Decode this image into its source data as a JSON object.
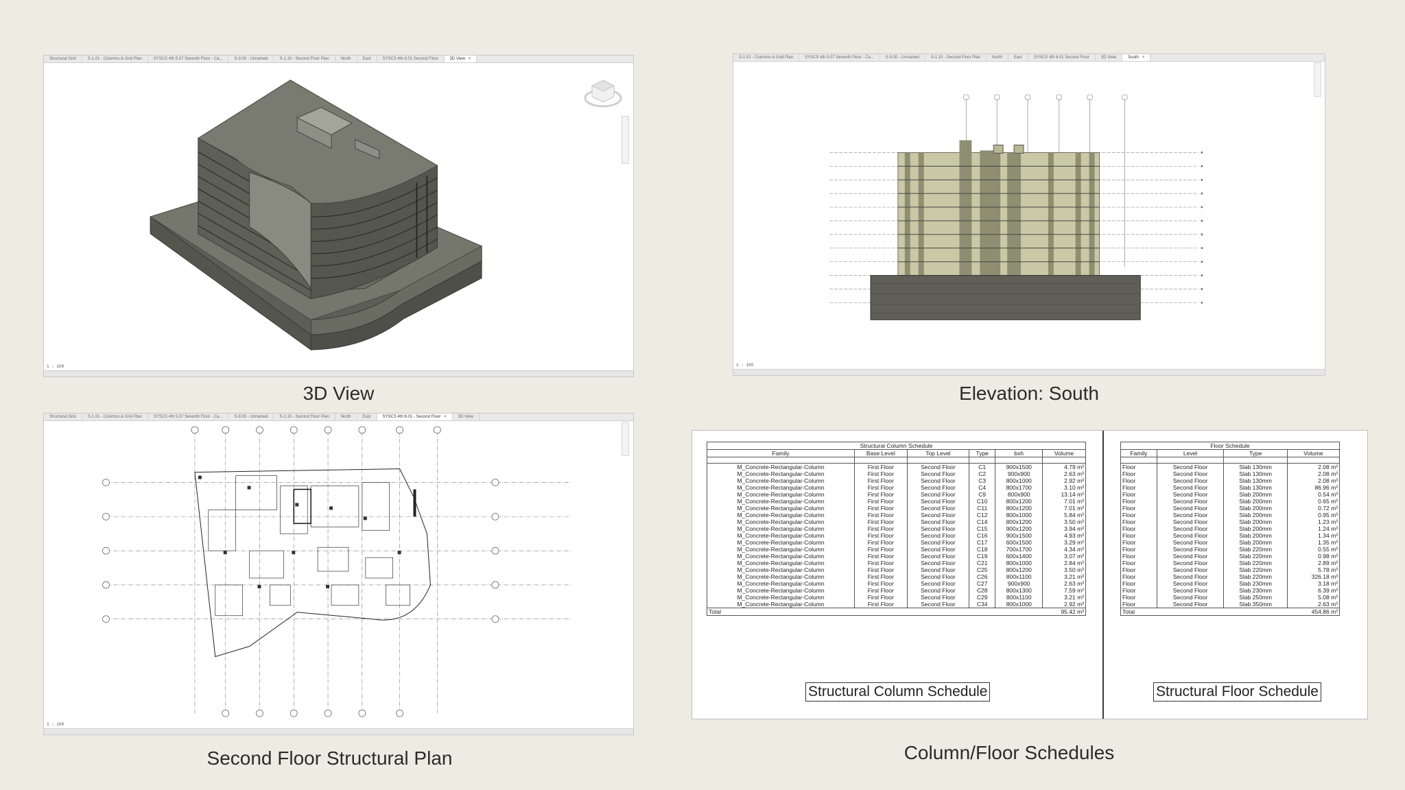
{
  "panels": {
    "view3d": {
      "tabs": [
        "Structural Grid",
        "S-1.01 - Columns & Grid Plan",
        "SYSCS 4th 5.07 Seventh Floor - Ca...",
        "S-9.00 - Unnamed",
        "S-1.10 - Second Floor Plan",
        "North",
        "East",
        "SYSCS 4th 6.01 Second Floor",
        "3D View"
      ],
      "active_tab": "3D View",
      "scale": "1 : 100",
      "caption": "3D View"
    },
    "elevation": {
      "tabs": [
        "S-1.01 - Columns & Grid Plan",
        "SYSCS 4th 5.07 Seventh Floor - Ca...",
        "S-9.00 - Unnamed",
        "S-1.10 - Second Floor Plan",
        "North",
        "East",
        "SYSCS 4th 6.01 Second Floor",
        "3D View",
        "South"
      ],
      "active_tab": "South",
      "scale": "1 : 100",
      "caption": "Elevation: South"
    },
    "plan": {
      "tabs": [
        "Structural Grid",
        "S-1.01 - Columns & Grid Plan",
        "SYSCS 4th 5.07 Seventh Floor - Ca...",
        "S-9.00 - Unnamed",
        "S-1.10 - Second Floor Plan",
        "North",
        "East",
        "SYSCS 4th 6.01 - Second Floor",
        "3D View"
      ],
      "active_tab": "SYSCS 4th 6.01 - Second Floor",
      "scale": "1 : 100",
      "caption": "Second Floor Structural Plan"
    },
    "schedules_caption": "Column/Floor Schedules"
  },
  "column_schedule": {
    "title": "Structural Column Schedule",
    "headers": [
      "Family",
      "Base Level",
      "Top Level",
      "Type",
      "bxh",
      "Volume"
    ],
    "rows": [
      [
        "M_Concrete-Rectangular-Column",
        "First Floor",
        "Second Floor",
        "C1",
        "900x1500",
        "4.79 m³"
      ],
      [
        "M_Concrete-Rectangular-Column",
        "First Floor",
        "Second Floor",
        "C2",
        "900x900",
        "2.63 m³"
      ],
      [
        "M_Concrete-Rectangular-Column",
        "First Floor",
        "Second Floor",
        "C3",
        "800x1000",
        "2.92 m³"
      ],
      [
        "M_Concrete-Rectangular-Column",
        "First Floor",
        "Second Floor",
        "C4",
        "800x1700",
        "3.10 m³"
      ],
      [
        "M_Concrete-Rectangular-Column",
        "First Floor",
        "Second Floor",
        "C9",
        "800x900",
        "13.14 m³"
      ],
      [
        "M_Concrete-Rectangular-Column",
        "First Floor",
        "Second Floor",
        "C10",
        "800x1200",
        "7.01 m³"
      ],
      [
        "M_Concrete-Rectangular-Column",
        "First Floor",
        "Second Floor",
        "C11",
        "800x1200",
        "7.01 m³"
      ],
      [
        "M_Concrete-Rectangular-Column",
        "First Floor",
        "Second Floor",
        "C12",
        "800x1000",
        "5.84 m³"
      ],
      [
        "M_Concrete-Rectangular-Column",
        "First Floor",
        "Second Floor",
        "C14",
        "800x1200",
        "3.50 m³"
      ],
      [
        "M_Concrete-Rectangular-Column",
        "First Floor",
        "Second Floor",
        "C15",
        "900x1200",
        "3.94 m³"
      ],
      [
        "M_Concrete-Rectangular-Column",
        "First Floor",
        "Second Floor",
        "C16",
        "900x1500",
        "4.93 m³"
      ],
      [
        "M_Concrete-Rectangular-Column",
        "First Floor",
        "Second Floor",
        "C17",
        "600x1500",
        "3.29 m³"
      ],
      [
        "M_Concrete-Rectangular-Column",
        "First Floor",
        "Second Floor",
        "C18",
        "700x1700",
        "4.34 m³"
      ],
      [
        "M_Concrete-Rectangular-Column",
        "First Floor",
        "Second Floor",
        "C19",
        "600x1400",
        "3.07 m³"
      ],
      [
        "M_Concrete-Rectangular-Column",
        "First Floor",
        "Second Floor",
        "C21",
        "800x1000",
        "2.84 m³"
      ],
      [
        "M_Concrete-Rectangular-Column",
        "First Floor",
        "Second Floor",
        "C25",
        "800x1200",
        "3.50 m³"
      ],
      [
        "M_Concrete-Rectangular-Column",
        "First Floor",
        "Second Floor",
        "C26",
        "800x1100",
        "3.21 m³"
      ],
      [
        "M_Concrete-Rectangular-Column",
        "First Floor",
        "Second Floor",
        "C27",
        "900x900",
        "2.63 m³"
      ],
      [
        "M_Concrete-Rectangular-Column",
        "First Floor",
        "Second Floor",
        "C28",
        "800x1300",
        "7.59 m³"
      ],
      [
        "M_Concrete-Rectangular-Column",
        "First Floor",
        "Second Floor",
        "C29",
        "800x1100",
        "3.21 m³"
      ],
      [
        "M_Concrete-Rectangular-Column",
        "First Floor",
        "Second Floor",
        "C34",
        "800x1000",
        "2.92 m³"
      ]
    ],
    "total_label": "Total",
    "total_value": "95.42 m³",
    "label": "Structural Column Schedule"
  },
  "floor_schedule": {
    "title": "Floor Schedule",
    "headers": [
      "Family",
      "Level",
      "Type",
      "Volume"
    ],
    "rows": [
      [
        "Floor",
        "Second Floor",
        "Slab 130mm",
        "2.08 m³"
      ],
      [
        "Floor",
        "Second Floor",
        "Slab 130mm",
        "2.08 m³"
      ],
      [
        "Floor",
        "Second Floor",
        "Slab 130mm",
        "2.08 m³"
      ],
      [
        "Floor",
        "Second Floor",
        "Slab 130mm",
        "86.96 m³"
      ],
      [
        "Floor",
        "Second Floor",
        "Slab 200mm",
        "0.54 m³"
      ],
      [
        "Floor",
        "Second Floor",
        "Slab 200mm",
        "0.65 m³"
      ],
      [
        "Floor",
        "Second Floor",
        "Slab 200mm",
        "0.72 m³"
      ],
      [
        "Floor",
        "Second Floor",
        "Slab 200mm",
        "0.95 m³"
      ],
      [
        "Floor",
        "Second Floor",
        "Slab 200mm",
        "1.23 m³"
      ],
      [
        "Floor",
        "Second Floor",
        "Slab 200mm",
        "1.24 m³"
      ],
      [
        "Floor",
        "Second Floor",
        "Slab 200mm",
        "1.34 m³"
      ],
      [
        "Floor",
        "Second Floor",
        "Slab 200mm",
        "1.35 m³"
      ],
      [
        "Floor",
        "Second Floor",
        "Slab 220mm",
        "0.55 m³"
      ],
      [
        "Floor",
        "Second Floor",
        "Slab 220mm",
        "0.98 m³"
      ],
      [
        "Floor",
        "Second Floor",
        "Slab 220mm",
        "2.89 m³"
      ],
      [
        "Floor",
        "Second Floor",
        "Slab 220mm",
        "5.78 m³"
      ],
      [
        "Floor",
        "Second Floor",
        "Slab 220mm",
        "326.18 m³"
      ],
      [
        "Floor",
        "Second Floor",
        "Slab 230mm",
        "3.18 m³"
      ],
      [
        "Floor",
        "Second Floor",
        "Slab 230mm",
        "6.39 m³"
      ],
      [
        "Floor",
        "Second Floor",
        "Slab 250mm",
        "5.08 m³"
      ],
      [
        "Floor",
        "Second Floor",
        "Slab 350mm",
        "2.63 m³"
      ]
    ],
    "total_label": "Total",
    "total_value": "454.86 m³",
    "label": "Structural Floor Schedule"
  }
}
